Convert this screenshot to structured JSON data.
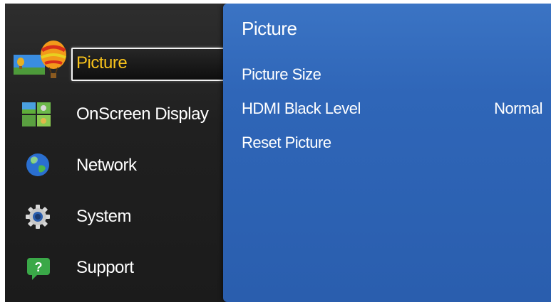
{
  "menu": {
    "items": [
      {
        "label": "Picture",
        "icon": "picture-icon",
        "selected": true
      },
      {
        "label": "OnScreen Display",
        "icon": "onscreen-display-icon",
        "selected": false
      },
      {
        "label": "Network",
        "icon": "network-icon",
        "selected": false
      },
      {
        "label": "System",
        "icon": "system-icon",
        "selected": false
      },
      {
        "label": "Support",
        "icon": "support-icon",
        "selected": false
      }
    ],
    "selected_color": "#f7c21b"
  },
  "panel": {
    "title": "Picture",
    "items": [
      {
        "label": "Picture Size",
        "value": ""
      },
      {
        "label": "HDMI Black Level",
        "value": "Normal"
      },
      {
        "label": "Reset Picture",
        "value": ""
      }
    ],
    "background_color": "#2f66b8"
  }
}
